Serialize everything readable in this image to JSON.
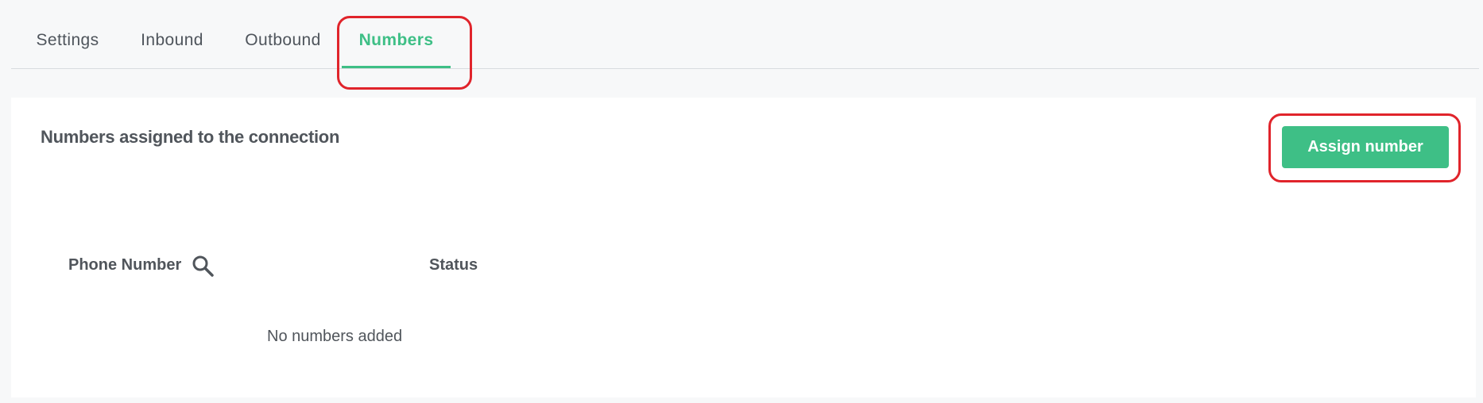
{
  "tabs": {
    "items": [
      {
        "label": "Settings"
      },
      {
        "label": "Inbound"
      },
      {
        "label": "Outbound"
      },
      {
        "label": "Numbers",
        "active": true
      }
    ]
  },
  "card": {
    "title": "Numbers assigned to the connection",
    "assign_button_label": "Assign number"
  },
  "table": {
    "columns": [
      "Phone Number",
      "Status"
    ],
    "empty_message": "No numbers added"
  },
  "colors": {
    "accent": "#3ebf86",
    "highlight": "#e0242b",
    "background": "#f7f8f9"
  },
  "icons": {
    "phone_search": "search-icon"
  }
}
